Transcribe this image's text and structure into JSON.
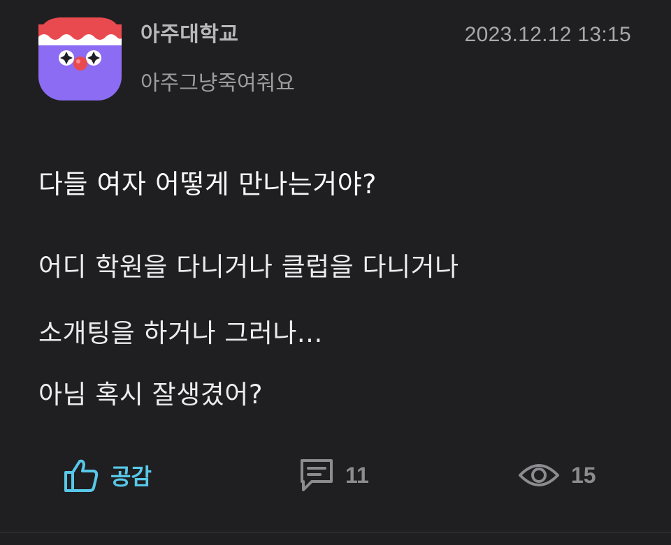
{
  "post": {
    "school": "아주대학교",
    "nickname": "아주그냥죽여줘요",
    "timestamp": "2023.12.12 13:15",
    "title": "다들 여자 어떻게 만나는거야?",
    "body_lines": [
      "어디 학원을 다니거나 클럽을 다니거나",
      "소개팅을 하거나 그러나...",
      "아님 혹시 잘생겼어?"
    ]
  },
  "actions": {
    "like_label": "공감",
    "like_icon": "thumbs-up-icon",
    "comment_count": "11",
    "comment_icon": "comment-icon",
    "view_count": "15",
    "view_icon": "eye-icon"
  },
  "colors": {
    "background": "#1f1f21",
    "accent": "#58c8e8",
    "avatar_purple": "#8c6cf3",
    "avatar_hat": "#e94a4f",
    "muted": "#8b8b90"
  }
}
